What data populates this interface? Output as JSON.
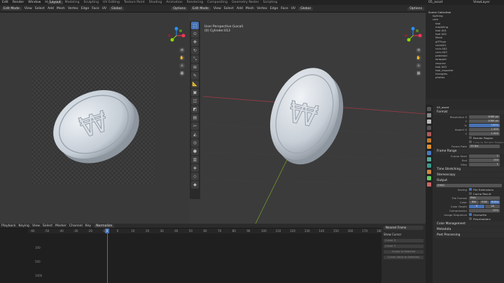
{
  "top_menu": [
    "Edit",
    "Render",
    "Window",
    "Help"
  ],
  "workspace_title": "Blender [...]",
  "tabs": [
    "Layout",
    "Modeling",
    "Sculpting",
    "UV Editing",
    "Texture Paint",
    "Shading",
    "Animation",
    "Rendering",
    "Compositing",
    "Geometry Nodes",
    "Scripting"
  ],
  "scene_name": "05_asset",
  "view_layer": "ViewLayer",
  "left_header": {
    "mode": "Edit Mode",
    "view": "View",
    "select": "Select",
    "add": "Add",
    "mesh": "Mesh",
    "vertex": "Vertex",
    "edge": "Edge",
    "face": "Face",
    "uv": "UV",
    "orient": "Global",
    "options": "Options"
  },
  "right_header": {
    "mode": "Edit Mode",
    "view": "View",
    "select": "Select",
    "add": "Add",
    "mesh": "Mesh",
    "vertex": "Vertex",
    "edge": "Edge",
    "face": "Face",
    "uv": "UV",
    "orient": "Global",
    "options": "Options"
  },
  "viewport_info": {
    "line1": "User Perspective (Local)",
    "line2": "(0) Cylinder.013"
  },
  "coin_symbol": "₩",
  "timeline": {
    "menu": [
      "Playback",
      "Keying",
      "View",
      "Select",
      "Marker",
      "Channel",
      "Key"
    ],
    "mode": "Normalize",
    "frame": "0",
    "ruler": [
      "-60",
      "-50",
      "-40",
      "-30",
      "-20",
      "-10",
      "0",
      "10",
      "20",
      "30",
      "40",
      "50",
      "60",
      "70",
      "80",
      "90",
      "100",
      "110",
      "120",
      "130",
      "140",
      "150",
      "160",
      "170",
      "180"
    ],
    "values": [
      "100",
      "500",
      "1000"
    ]
  },
  "sidebar": {
    "dropdown": "Nearest Frame",
    "section": "Show Cursor",
    "field1": "Cursor X",
    "field2": "Cursor Y",
    "btn1": "Cursor to Selected",
    "btn2": "Cursor Value to Selection"
  },
  "outliner": {
    "collection": "Scene Collection",
    "items": [
      "lighting",
      "cam",
      "tool",
      "modeling",
      "tool.001",
      "tool.002",
      "Mesh",
      "glTFbox",
      "coin001",
      "coin.002",
      "coin.003",
      "pedestal",
      "wrapper",
      "resume",
      "tool.003",
      "tool_exporter",
      "triangles",
      "photos"
    ]
  },
  "props": {
    "object": "05_asset",
    "format_title": "Format",
    "res_x_label": "Resolution X",
    "res_x": "1080 px",
    "res_y_label": "Y",
    "res_y": "1080 px",
    "pct_label": "%",
    "pct": "100%",
    "asp_x_label": "Aspect X",
    "asp_x": "1.000",
    "asp_y_label": "Y",
    "asp_y": "1.000",
    "render_region": "Render Region",
    "crop": "Crop to Render Region",
    "fps_label": "Frame Rate",
    "fps": "24 fps",
    "frame_range_title": "Frame Range",
    "start_label": "Frame Start",
    "start": "1",
    "end_label": "End",
    "end": "250",
    "step_label": "Step",
    "step": "1",
    "time_stretching": "Time Stretching",
    "stereoscopy": "Stereoscopy",
    "output_title": "Output",
    "path": "/tmp\\",
    "saving_label": "Saving",
    "file_ext": "File Extensions",
    "cache": "Cache Result",
    "file_format_label": "File Format",
    "file_format": "PNG",
    "color_label": "Color",
    "bw": "BW",
    "rgb": "RGB",
    "rgba": "RGBA",
    "depth_label": "Color Depth",
    "depth8": "8",
    "depth16": "16",
    "compression_label": "Compression",
    "compression": "15%",
    "image_seq_label": "Image Sequence",
    "overwrite": "Overwrite",
    "placeholders": "Placeholders",
    "color_mgmt": "Color Management",
    "metadata": "Metadata",
    "post": "Post Processing"
  },
  "colors": {
    "accent": "#4772b3",
    "x_axis": "#ff3352",
    "y_axis": "#8bdc00",
    "z_axis": "#2890ff"
  }
}
